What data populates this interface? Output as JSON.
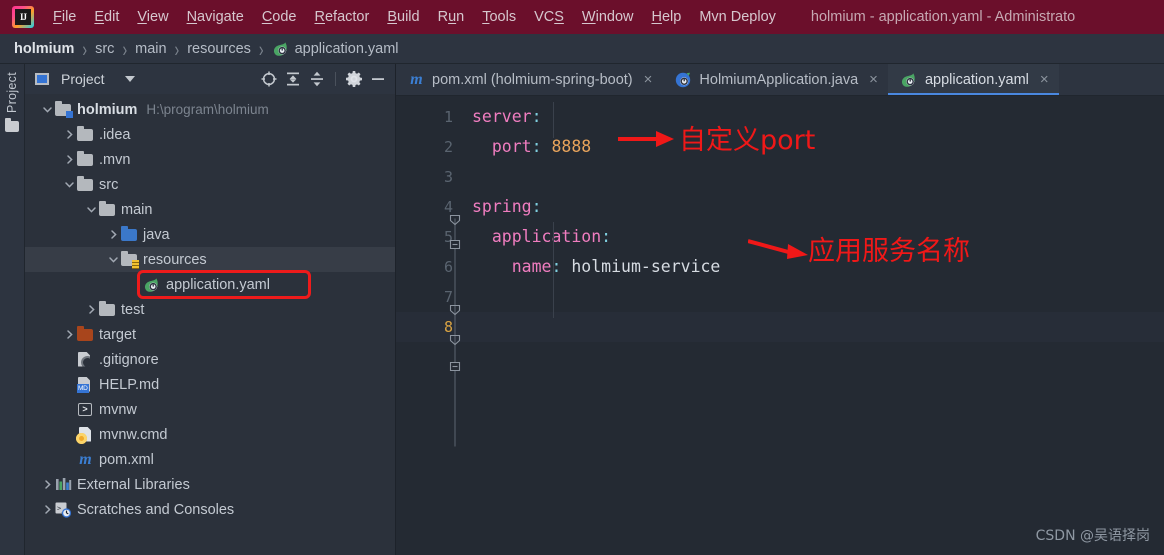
{
  "window": {
    "title": "holmium - application.yaml - Administrato",
    "logo_icon": "intellij-idea-logo"
  },
  "menubar": {
    "items": [
      {
        "label": "File",
        "mnemonic": "F"
      },
      {
        "label": "Edit",
        "mnemonic": "E"
      },
      {
        "label": "View",
        "mnemonic": "V"
      },
      {
        "label": "Navigate",
        "mnemonic": "N"
      },
      {
        "label": "Code",
        "mnemonic": "C"
      },
      {
        "label": "Refactor",
        "mnemonic": "R"
      },
      {
        "label": "Build",
        "mnemonic": "B"
      },
      {
        "label": "Run",
        "mnemonic": "u"
      },
      {
        "label": "Tools",
        "mnemonic": "T"
      },
      {
        "label": "VCS",
        "mnemonic": "S"
      },
      {
        "label": "Window",
        "mnemonic": "W"
      },
      {
        "label": "Help",
        "mnemonic": "H"
      },
      {
        "label": "Mvn Deploy",
        "mnemonic": ""
      }
    ]
  },
  "breadcrumb": {
    "separator": "›",
    "items": [
      {
        "label": "holmium",
        "icon": ""
      },
      {
        "label": "src",
        "icon": ""
      },
      {
        "label": "main",
        "icon": ""
      },
      {
        "label": "resources",
        "icon": ""
      },
      {
        "label": "application.yaml",
        "icon": "spring-leaf-icon"
      }
    ]
  },
  "toolstrip": {
    "project_label": "Project",
    "folder_icon": "folder-icon"
  },
  "project_panel": {
    "title": "Project",
    "title_icon": "project-view-icon",
    "dropdown_icon": "chevron-down-icon",
    "toolbar_icons": [
      "locate-target-icon",
      "expand-all-icon",
      "collapse-all-icon",
      "settings-gear-icon",
      "hide-panel-icon"
    ],
    "tree": [
      {
        "label": "holmium",
        "path": "H:\\program\\holmium",
        "depth": 0,
        "icon": "module-folder-icon",
        "state": "expanded",
        "bold": true
      },
      {
        "label": ".idea",
        "path": "",
        "depth": 1,
        "icon": "folder-gray-icon",
        "state": "collapsed",
        "bold": false
      },
      {
        "label": ".mvn",
        "path": "",
        "depth": 1,
        "icon": "folder-gray-icon",
        "state": "collapsed",
        "bold": false
      },
      {
        "label": "src",
        "path": "",
        "depth": 1,
        "icon": "folder-gray-icon",
        "state": "expanded",
        "bold": false
      },
      {
        "label": "main",
        "path": "",
        "depth": 2,
        "icon": "folder-gray-icon",
        "state": "expanded",
        "bold": false
      },
      {
        "label": "java",
        "path": "",
        "depth": 3,
        "icon": "source-root-icon",
        "state": "collapsed",
        "bold": false
      },
      {
        "label": "resources",
        "path": "",
        "depth": 3,
        "icon": "resource-root-icon",
        "state": "expanded",
        "bold": false,
        "selected": true
      },
      {
        "label": "application.yaml",
        "path": "",
        "depth": 4,
        "icon": "spring-leaf-icon",
        "state": "none",
        "bold": false,
        "highlighted": true
      },
      {
        "label": "test",
        "path": "",
        "depth": 2,
        "icon": "folder-gray-icon",
        "state": "collapsed",
        "bold": false
      },
      {
        "label": "target",
        "path": "",
        "depth": 1,
        "icon": "folder-excluded-icon",
        "state": "collapsed",
        "bold": false
      },
      {
        "label": ".gitignore",
        "path": "",
        "depth": 1,
        "icon": "gitignore-file-icon",
        "state": "none",
        "bold": false
      },
      {
        "label": "HELP.md",
        "path": "",
        "depth": 1,
        "icon": "markdown-file-icon",
        "state": "none",
        "bold": false
      },
      {
        "label": "mvnw",
        "path": "",
        "depth": 1,
        "icon": "shell-script-icon",
        "state": "none",
        "bold": false
      },
      {
        "label": "mvnw.cmd",
        "path": "",
        "depth": 1,
        "icon": "cmd-script-icon",
        "state": "none",
        "bold": false
      },
      {
        "label": "pom.xml",
        "path": "",
        "depth": 1,
        "icon": "maven-file-icon",
        "state": "none",
        "bold": false
      },
      {
        "label": "External Libraries",
        "path": "",
        "depth": 0,
        "icon": "libraries-icon",
        "state": "collapsed",
        "bold": false
      },
      {
        "label": "Scratches and Consoles",
        "path": "",
        "depth": 0,
        "icon": "scratches-icon",
        "state": "collapsed",
        "bold": false
      }
    ]
  },
  "editor": {
    "tabs": [
      {
        "label": "pom.xml (holmium-spring-boot)",
        "icon": "maven-file-icon",
        "active": false,
        "close_icon": "×"
      },
      {
        "label": "HolmiumApplication.java",
        "icon": "spring-boot-icon",
        "active": false,
        "close_icon": "×"
      },
      {
        "label": "application.yaml",
        "icon": "spring-leaf-icon",
        "active": true,
        "close_icon": "×"
      }
    ],
    "line_numbers": [
      "1",
      "2",
      "3",
      "4",
      "5",
      "6",
      "7",
      "8"
    ],
    "current_line": 8,
    "lines": [
      {
        "n": 1,
        "tokens": [
          {
            "t": "server",
            "c": "k"
          },
          {
            "t": ":",
            "c": "p"
          }
        ],
        "indent": 0
      },
      {
        "n": 2,
        "tokens": [
          {
            "t": "  port",
            "c": "k"
          },
          {
            "t": ": ",
            "c": "p"
          },
          {
            "t": "8888",
            "c": "num"
          }
        ],
        "indent": 0
      },
      {
        "n": 3,
        "tokens": [],
        "indent": 0
      },
      {
        "n": 4,
        "tokens": [
          {
            "t": "spring",
            "c": "k"
          },
          {
            "t": ":",
            "c": "p"
          }
        ],
        "indent": 0
      },
      {
        "n": 5,
        "tokens": [
          {
            "t": "  application",
            "c": "k"
          },
          {
            "t": ":",
            "c": "p"
          }
        ],
        "indent": 0
      },
      {
        "n": 6,
        "tokens": [
          {
            "t": "    name",
            "c": "k"
          },
          {
            "t": ": ",
            "c": "p"
          },
          {
            "t": "holmium-service",
            "c": "txt"
          }
        ],
        "indent": 0
      },
      {
        "n": 7,
        "tokens": [],
        "indent": 0
      },
      {
        "n": 8,
        "tokens": [],
        "indent": 0
      }
    ]
  },
  "annotations": [
    {
      "text": "自定义port",
      "target_line": 2,
      "color": "#f01818",
      "arrow": "right-arrow"
    },
    {
      "text": "应用服务名称",
      "target_line": 6,
      "color": "#f01818",
      "arrow": "right-arrow"
    }
  ],
  "watermark": {
    "text": "CSDN @吴语择岗"
  },
  "colors": {
    "menubar_bg": "#6b0f2b",
    "panel_bg": "#2b313b",
    "editor_bg": "#242a33",
    "accent": "#4a88e0",
    "annotation_red": "#f01818",
    "yaml_key": "#f07dc0",
    "yaml_number": "#e8a45c"
  }
}
